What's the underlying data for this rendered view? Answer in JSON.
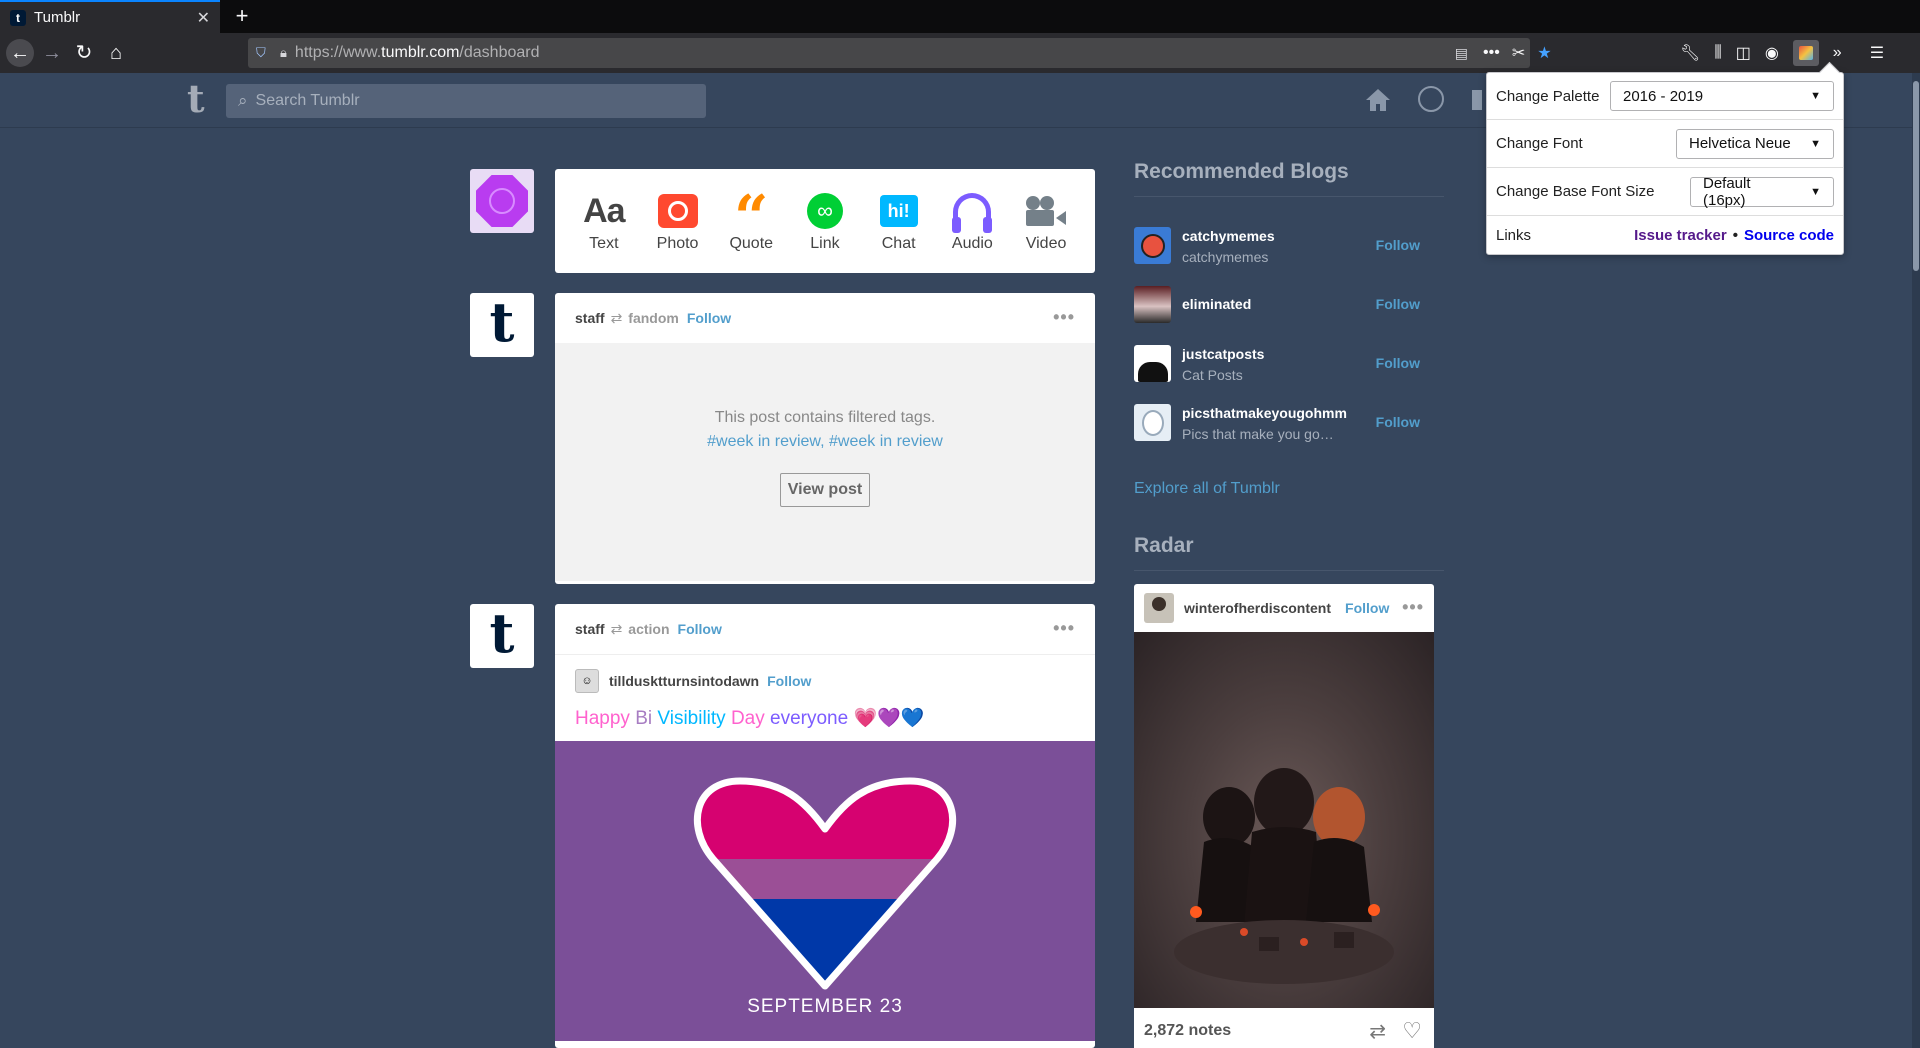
{
  "browser": {
    "tab_title": "Tumblr",
    "tab_favicon": "t",
    "url_prefix": "https://www.",
    "url_host": "tumblr.com",
    "url_path": "/dashboard"
  },
  "header": {
    "logo": "t",
    "search_placeholder": "Search Tumblr"
  },
  "composer": {
    "types": [
      "Text",
      "Photo",
      "Quote",
      "Link",
      "Chat",
      "Audio",
      "Video"
    ],
    "text_icon": "Aa",
    "chat_icon": "hi!"
  },
  "posts": [
    {
      "blog": "staff",
      "via": "fandom",
      "follow": "Follow",
      "filtered_msg": "This post contains filtered tags.",
      "filtered_tags": "#week in review, #week in review",
      "view_button": "View post"
    },
    {
      "blog": "staff",
      "via": "action",
      "follow": "Follow",
      "trail_blog": "tilldusktturnsintodawn",
      "trail_follow": "Follow",
      "text_words": [
        "Happy",
        "Bi",
        "Visibility",
        "Day",
        "everyone"
      ],
      "text_colors": [
        "#ff62ce",
        "#a77dc2",
        "#00b8ff",
        "#ff62ce",
        "#7c5cff"
      ],
      "emoji": "💗💜💙",
      "image_caption": "SEPTEMBER 23"
    }
  ],
  "sidebar": {
    "recommended_title": "Recommended Blogs",
    "blogs": [
      {
        "name": "catchymemes",
        "sub": "catchymemes",
        "follow": "Follow"
      },
      {
        "name": "eliminated",
        "sub": "",
        "follow": "Follow"
      },
      {
        "name": "justcatposts",
        "sub": "Cat Posts",
        "follow": "Follow"
      },
      {
        "name": "picsthatmakeyougohmm",
        "sub": "Pics that make you go…",
        "follow": "Follow"
      }
    ],
    "explore_link": "Explore all of Tumblr",
    "radar_title": "Radar",
    "radar": {
      "blog": "winterofherdiscontent",
      "follow": "Follow",
      "notes": "2,872 notes"
    }
  },
  "popup": {
    "palette_label": "Change Palette",
    "palette_value": "2016 - 2019",
    "font_label": "Change Font",
    "font_value": "Helvetica Neue",
    "size_label": "Change Base Font Size",
    "size_value": "Default (16px)",
    "links_label": "Links",
    "link_issue": "Issue tracker",
    "link_sep": "•",
    "link_source": "Source code"
  },
  "colors": {
    "tumblr_bg": "#36465d",
    "link_blue": "#529ecc",
    "bi_pink": "#d60270",
    "bi_purple": "#9b4f96",
    "bi_blue": "#0038a8"
  }
}
